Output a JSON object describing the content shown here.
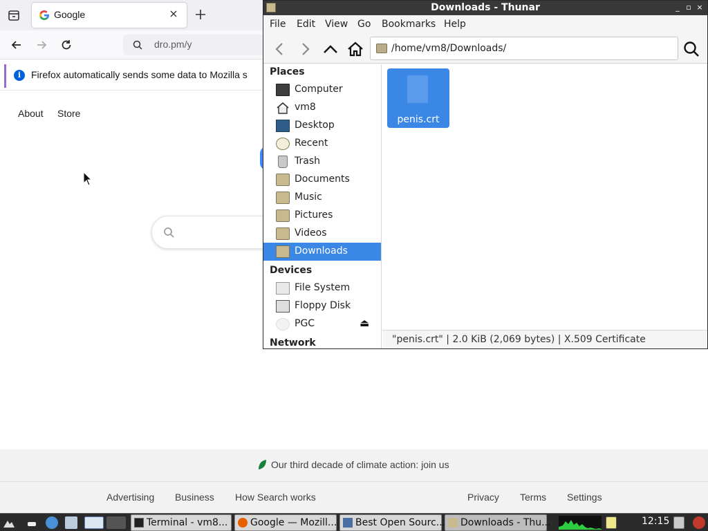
{
  "firefox": {
    "tab_title": "Google",
    "url_text": "dro.pm/y",
    "notification_text": "Firefox automatically sends some data to Mozilla s",
    "notification_icon": "i",
    "newtab_label": "+"
  },
  "google": {
    "top_links": [
      "About",
      "Store"
    ],
    "climate_text": "Our third decade of climate action: join us",
    "footer_left": [
      "Advertising",
      "Business",
      "How Search works"
    ],
    "footer_right": [
      "Privacy",
      "Terms",
      "Settings"
    ]
  },
  "thunar": {
    "title": "Downloads - Thunar",
    "window_buttons": [
      "_",
      "▫",
      "×"
    ],
    "menu": [
      "File",
      "Edit",
      "View",
      "Go",
      "Bookmarks",
      "Help"
    ],
    "path": "/home/vm8/Downloads/",
    "sections": {
      "places": "Places",
      "devices": "Devices",
      "network": "Network"
    },
    "places": [
      {
        "label": "Computer",
        "icon": "computer-icon"
      },
      {
        "label": "vm8",
        "icon": "home-icon"
      },
      {
        "label": "Desktop",
        "icon": "desktop-icon"
      },
      {
        "label": "Recent",
        "icon": "recent-icon"
      },
      {
        "label": "Trash",
        "icon": "trash-icon"
      },
      {
        "label": "Documents",
        "icon": "folder-icon"
      },
      {
        "label": "Music",
        "icon": "folder-icon"
      },
      {
        "label": "Pictures",
        "icon": "folder-icon"
      },
      {
        "label": "Videos",
        "icon": "folder-icon"
      },
      {
        "label": "Downloads",
        "icon": "folder-icon",
        "selected": true
      }
    ],
    "devices": [
      {
        "label": "File System",
        "icon": "harddisk-icon"
      },
      {
        "label": "Floppy Disk",
        "icon": "floppy-icon"
      },
      {
        "label": "PGC",
        "icon": "optical-disc-icon",
        "eject": "⏏"
      }
    ],
    "file": {
      "name": "penis.crt"
    },
    "status": "\"penis.crt\"  |  2.0 KiB (2,069 bytes)  |  X.509 Certificate",
    "accent_color": "#3a87e6"
  },
  "panel": {
    "tasks": [
      "Terminal - vm8...",
      "Google — Mozill...",
      "Best Open Sourc...",
      "Downloads - Thu..."
    ],
    "clock": "12:15"
  }
}
